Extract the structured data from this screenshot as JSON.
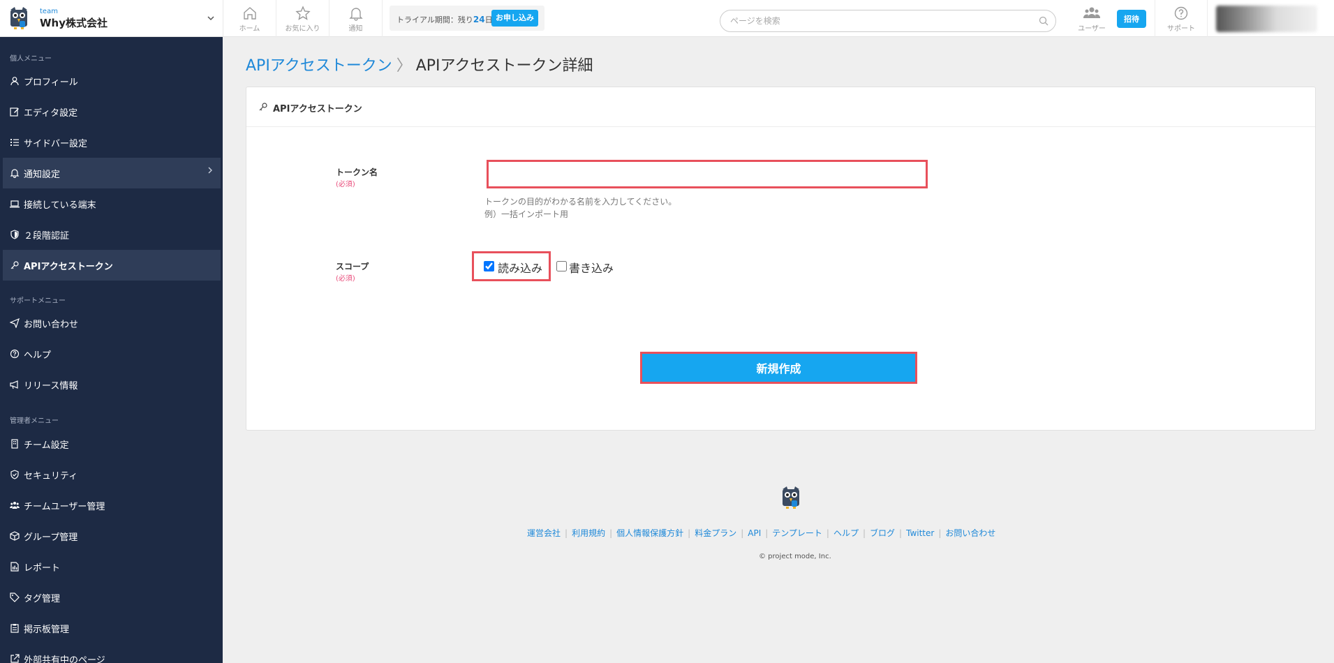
{
  "team": {
    "label": "team",
    "name": "Why株式会社"
  },
  "nav": {
    "home": "ホーム",
    "favorites": "お気に入り",
    "notifications": "通知"
  },
  "trial": {
    "prefix": "トライアル期間：残り",
    "days": "24",
    "suffix": "日",
    "apply_label": "お申し込み"
  },
  "search": {
    "placeholder": "ページを検索",
    "value": ""
  },
  "header_right": {
    "users": "ユーザー",
    "invite": "招待",
    "support": "サポート"
  },
  "sidebar": {
    "personal_heading": "個人メニュー",
    "personal_items": [
      {
        "label": "プロフィール",
        "icon": "user-icon"
      },
      {
        "label": "エディタ設定",
        "icon": "edit-icon"
      },
      {
        "label": "サイドバー設定",
        "icon": "list-icon"
      },
      {
        "label": "通知設定",
        "icon": "bell-icon"
      },
      {
        "label": "接続している端末",
        "icon": "laptop-icon"
      },
      {
        "label": "２段階認証",
        "icon": "shield-icon"
      },
      {
        "label": "APIアクセストークン",
        "icon": "key-icon"
      }
    ],
    "support_heading": "サポートメニュー",
    "support_items": [
      {
        "label": "お問い合わせ",
        "icon": "send-icon"
      },
      {
        "label": "ヘルプ",
        "icon": "help-icon"
      },
      {
        "label": "リリース情報",
        "icon": "megaphone-icon"
      }
    ],
    "admin_heading": "管理者メニュー",
    "admin_items": [
      {
        "label": "チーム設定",
        "icon": "building-icon"
      },
      {
        "label": "セキュリティ",
        "icon": "shield-check-icon"
      },
      {
        "label": "チームユーザー管理",
        "icon": "users-icon"
      },
      {
        "label": "グループ管理",
        "icon": "box-icon"
      },
      {
        "label": "レポート",
        "icon": "report-icon"
      },
      {
        "label": "タグ管理",
        "icon": "tag-icon"
      },
      {
        "label": "掲示板管理",
        "icon": "clipboard-icon"
      },
      {
        "label": "外部共有中のページ",
        "icon": "external-link-icon"
      }
    ]
  },
  "breadcrumb": {
    "parent": "APIアクセストークン",
    "separator": "〉",
    "current": "APIアクセストークン詳細"
  },
  "card": {
    "title": "APIアクセストークン"
  },
  "form": {
    "token_label": "トークン名",
    "required": "(必須)",
    "token_value": "",
    "token_help_1": "トークンの目的がわかる名前を入力してください。",
    "token_help_2": "例）一括インポート用",
    "scope_label": "スコープ",
    "scope_read": "読み込み",
    "scope_write": "書き込み",
    "scope_read_checked": true,
    "scope_write_checked": false,
    "submit_label": "新規作成"
  },
  "footer": {
    "links": [
      "運営会社",
      "利用規約",
      "個人情報保護方針",
      "料金プラン",
      "API",
      "テンプレート",
      "ヘルプ",
      "ブログ",
      "Twitter",
      "お問い合わせ"
    ],
    "copyright": "© project mode, Inc."
  },
  "colors": {
    "accent": "#16a6f0",
    "link": "#1e88d8",
    "sidebar_bg": "#1d2a44",
    "highlight": "#e8505b",
    "required": "#e94b7a"
  }
}
